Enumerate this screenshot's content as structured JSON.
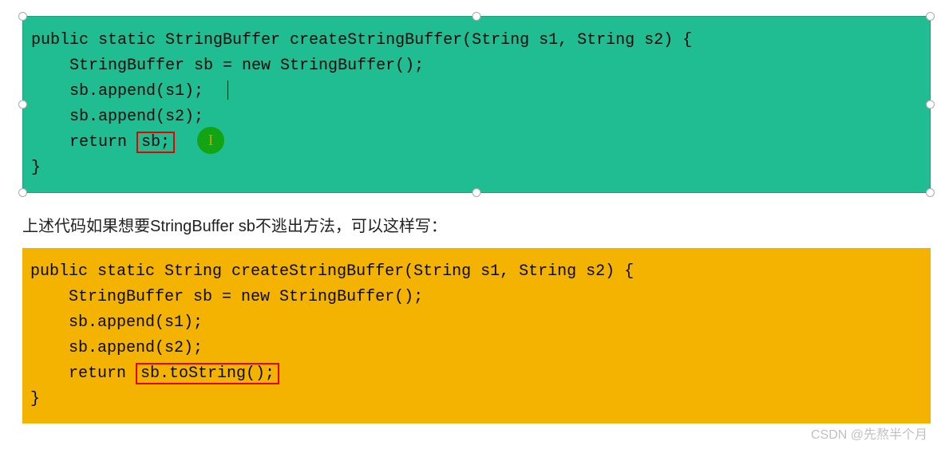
{
  "code_top": {
    "l1_pre": "public static StringBuffer createStringBuffer(String s1, String s2) {",
    "l2": "    StringBuffer sb = new StringBuffer();",
    "l3": "    sb.append(s1);",
    "l4": "    sb.append(s2);",
    "l5_pre": "    return ",
    "l5_hl": "sb;",
    "l6": "}"
  },
  "caption_text": "上述代码如果想要StringBuffer sb不逃出方法，可以这样写：",
  "code_bottom": {
    "l1_pre": "public static String createStringBuffer(String s1, String s2) {",
    "l2": "    StringBuffer sb = new StringBuffer();",
    "l3": "    sb.append(s1);",
    "l4": "    sb.append(s2);",
    "l5_pre": "    return ",
    "l5_hl": "sb.toString();",
    "l6": "}"
  },
  "cursor_glyph": "I",
  "watermark": "CSDN @先熬半个月"
}
